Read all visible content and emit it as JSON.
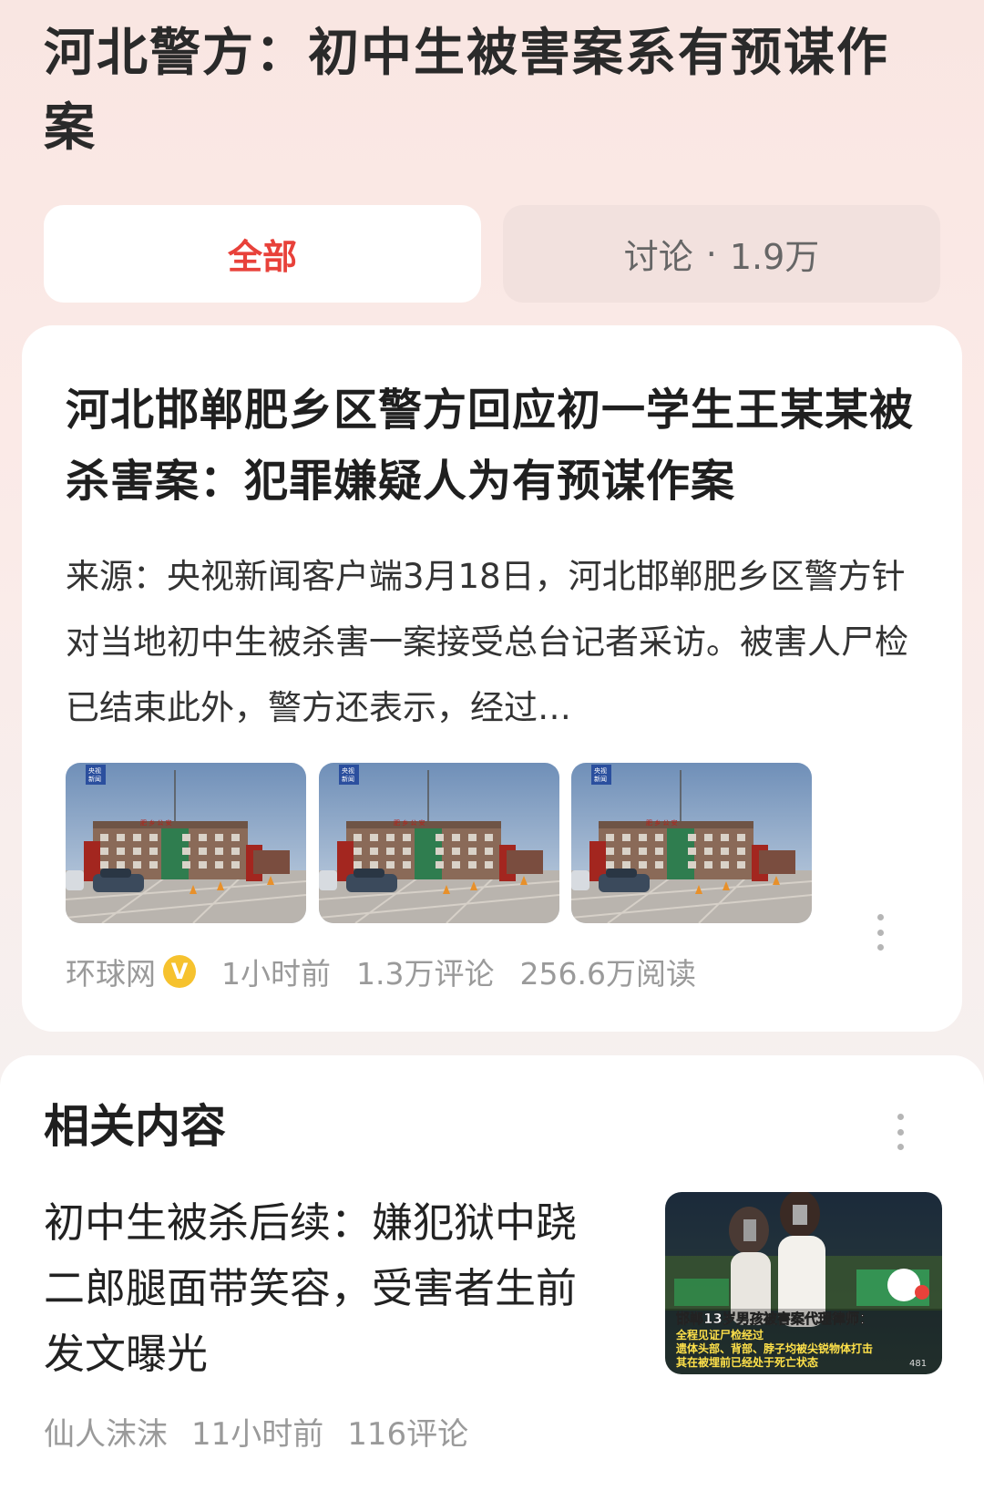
{
  "header": {
    "title": "河北警方：初中生被害案系有预谋作案"
  },
  "tabs": [
    {
      "label": "全部",
      "active": true
    },
    {
      "label": "讨论",
      "separator": "·",
      "count": "1.9万",
      "active": false
    }
  ],
  "article": {
    "title": "河北邯郸肥乡区警方回应初一学生王某某被杀害案：犯罪嫌疑人为有预谋作案",
    "summary": "来源：央视新闻客户端3月18日，河北邯郸肥乡区警方针对当地初中生被杀害一案接受总台记者采访。被害人尸检已结束此外，警方还表示，经过…",
    "thumb_watermark": [
      "央视",
      "新闻"
    ],
    "building_sign": "肥 乡 公 安",
    "source": "环球网",
    "verified_badge": "V",
    "time": "1小时前",
    "comments": "1.3万评论",
    "reads": "256.6万阅读"
  },
  "related": {
    "heading": "相关内容",
    "item": {
      "title": "初中生被杀后续：嫌犯狱中跷二郎腿面带笑容，受害者生前发文曝光",
      "thumb_caption_1": "邯郸13岁男孩被害案代理律师：",
      "thumb_caption_2": "全程见证尸检经过",
      "thumb_caption_3": "遗体头部、背部、脖子均被尖锐物体打击",
      "thumb_caption_4": "其在被埋前已经处于死亡状态",
      "thumb_views": "481",
      "author": "仙人沫沫",
      "time": "11小时前",
      "comments": "116评论"
    }
  },
  "colors": {
    "accent": "#e8413a",
    "verified": "#f6c22e"
  }
}
